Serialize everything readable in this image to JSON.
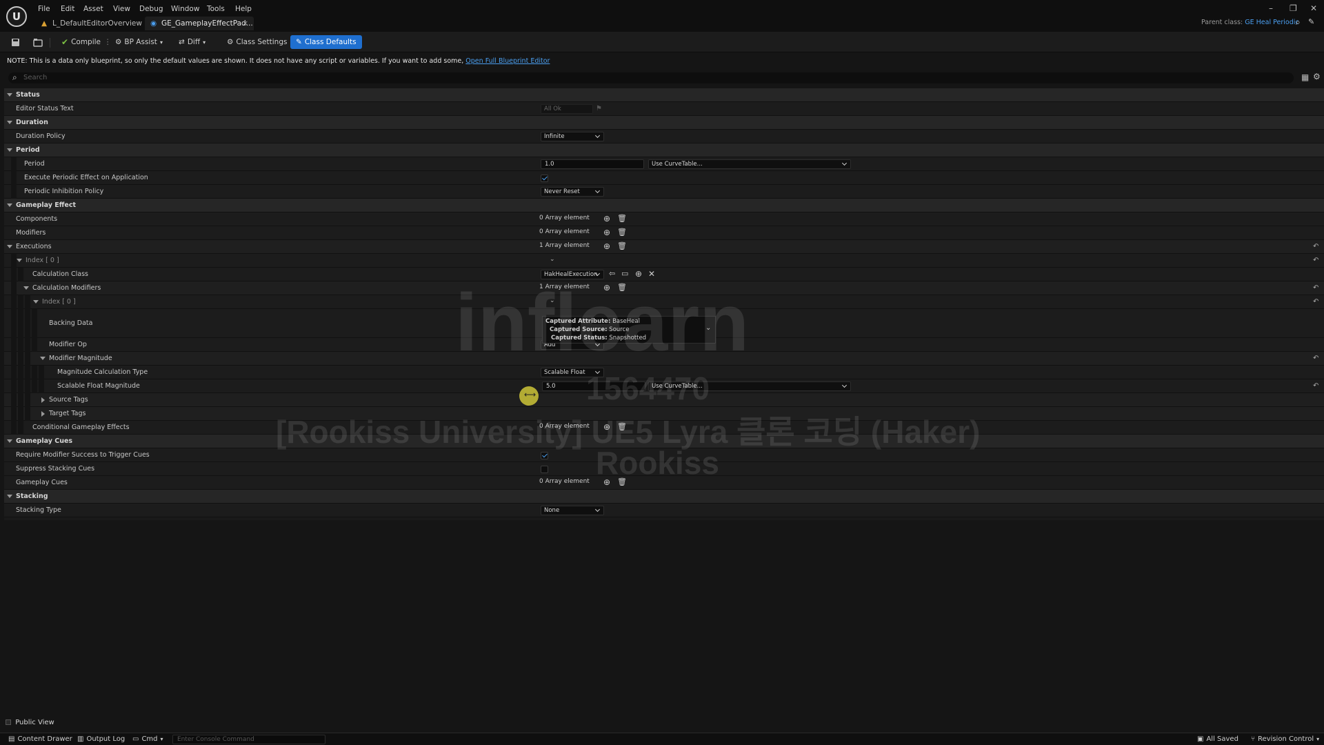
{
  "menu": [
    "File",
    "Edit",
    "Asset",
    "View",
    "Debug",
    "Window",
    "Tools",
    "Help"
  ],
  "tabs": [
    {
      "label": "L_DefaultEditorOverview"
    },
    {
      "label": "GE_GameplayEffectPad..."
    }
  ],
  "parent_class": {
    "prefix": "Parent class:",
    "value": "GE Heal Periodic"
  },
  "toolbar": {
    "compile": "Compile",
    "bp_assist": "BP Assist",
    "diff": "Diff",
    "class_settings": "Class Settings",
    "class_defaults": "Class Defaults"
  },
  "note": {
    "text": "NOTE: This is a data only blueprint, so only the default values are shown.  It does not have any script or variables.  If you want to add some,",
    "link": "Open Full Blueprint Editor"
  },
  "search_placeholder": "Search",
  "details": {
    "status": {
      "title": "Status",
      "editor_status_text": "Editor Status Text",
      "editor_status_value": "All Ok"
    },
    "duration": {
      "title": "Duration",
      "policy_label": "Duration Policy",
      "policy_value": "Infinite"
    },
    "period": {
      "title": "Period",
      "period_label": "Period",
      "period_value": "1.0",
      "curve_table": "Use CurveTable...",
      "exec_periodic_label": "Execute Periodic Effect on Application",
      "exec_periodic_checked": true,
      "inhibition_label": "Periodic Inhibition Policy",
      "inhibition_value": "Never Reset"
    },
    "gameplay_effect": {
      "title": "Gameplay Effect",
      "components_label": "Components",
      "components_value": "0 Array element",
      "modifiers_label": "Modifiers",
      "modifiers_value": "0 Array element",
      "executions_label": "Executions",
      "executions_value": "1 Array element",
      "index0_label": "Index [ 0 ]",
      "calc_class_label": "Calculation Class",
      "calc_class_value": "HakHealExecution",
      "calc_modifiers_label": "Calculation Modifiers",
      "calc_modifiers_value": "1 Array element",
      "inner_index_label": "Index [ 0 ]",
      "backing_data_label": "Backing Data",
      "backing": {
        "attr_key": "Captured Attribute:",
        "attr_val": "BaseHeal",
        "source_key": "Captured Source:",
        "source_val": "Source",
        "status_key": "Captured Status:",
        "status_val": "Snapshotted"
      },
      "modifier_op_label": "Modifier Op",
      "modifier_op_value": "Add",
      "mod_magnitude_label": "Modifier Magnitude",
      "mag_calc_type_label": "Magnitude Calculation Type",
      "mag_calc_type_value": "Scalable Float",
      "scalable_float_label": "Scalable Float Magnitude",
      "scalable_float_value": "5.0",
      "curve_table2": "Use CurveTable...",
      "source_tags_label": "Source Tags",
      "target_tags_label": "Target Tags",
      "cond_effects_label": "Conditional Gameplay Effects",
      "cond_effects_value": "0 Array element"
    },
    "gameplay_cues": {
      "title": "Gameplay Cues",
      "require_label": "Require Modifier Success to Trigger Cues",
      "require_checked": true,
      "suppress_label": "Suppress Stacking Cues",
      "suppress_checked": false,
      "cues_label": "Gameplay Cues",
      "cues_value": "0 Array element"
    },
    "stacking": {
      "title": "Stacking",
      "type_label": "Stacking Type",
      "type_value": "None"
    }
  },
  "watermark": {
    "brand": "inflearn",
    "id": "1564470",
    "course": "[Rookiss University] UE5 Lyra 클론 코딩 (Haker)",
    "author": "Rookiss"
  },
  "public_view": "Public View",
  "statusbar": {
    "content_drawer": "Content Drawer",
    "output_log": "Output Log",
    "cmd": "Cmd",
    "console_placeholder": "Enter Console Command",
    "all_saved": "All Saved",
    "revision_control": "Revision Control"
  }
}
